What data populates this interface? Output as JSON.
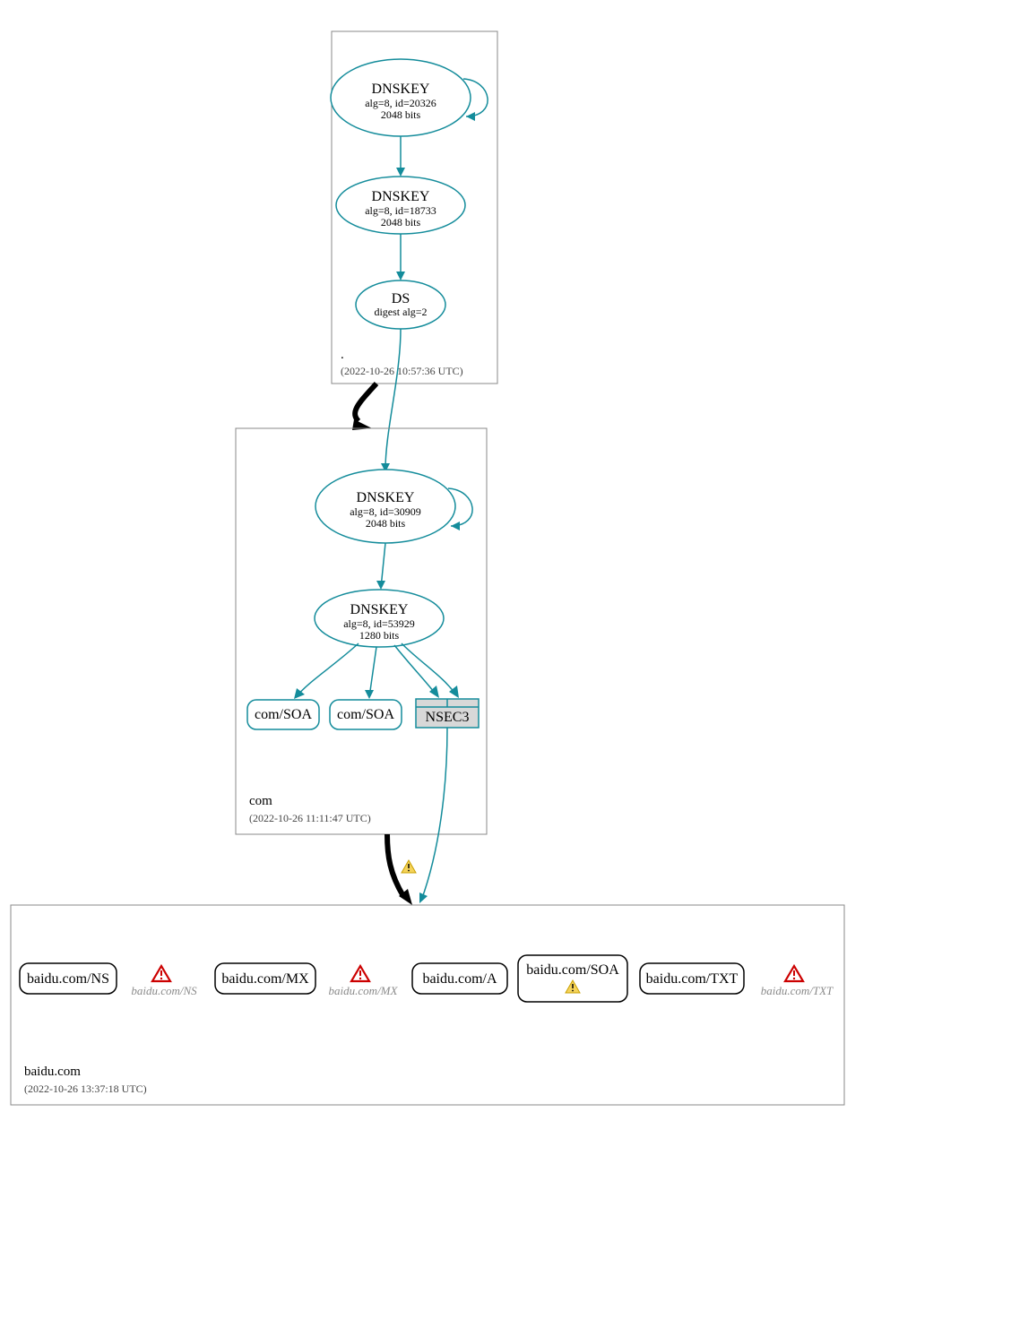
{
  "zones": {
    "root": {
      "name": ".",
      "timestamp": "(2022-10-26 10:57:36 UTC)",
      "nodes": {
        "ksk": {
          "title": "DNSKEY",
          "sub1": "alg=8, id=20326",
          "sub2": "2048 bits"
        },
        "zsk": {
          "title": "DNSKEY",
          "sub1": "alg=8, id=18733",
          "sub2": "2048 bits"
        },
        "ds": {
          "title": "DS",
          "sub1": "digest alg=2"
        }
      }
    },
    "com": {
      "name": "com",
      "timestamp": "(2022-10-26 11:11:47 UTC)",
      "nodes": {
        "ksk": {
          "title": "DNSKEY",
          "sub1": "alg=8, id=30909",
          "sub2": "2048 bits"
        },
        "zsk": {
          "title": "DNSKEY",
          "sub1": "alg=8, id=53929",
          "sub2": "1280 bits"
        },
        "soa1": {
          "title": "com/SOA"
        },
        "soa2": {
          "title": "com/SOA"
        },
        "nsec3": {
          "title": "NSEC3"
        }
      }
    },
    "baidu": {
      "name": "baidu.com",
      "timestamp": "(2022-10-26 13:37:18 UTC)",
      "nodes": {
        "ns": {
          "title": "baidu.com/NS"
        },
        "ns_e": {
          "title": "baidu.com/NS"
        },
        "mx": {
          "title": "baidu.com/MX"
        },
        "mx_e": {
          "title": "baidu.com/MX"
        },
        "a": {
          "title": "baidu.com/A"
        },
        "soa": {
          "title": "baidu.com/SOA"
        },
        "txt": {
          "title": "baidu.com/TXT"
        },
        "txt_e": {
          "title": "baidu.com/TXT"
        }
      }
    }
  }
}
